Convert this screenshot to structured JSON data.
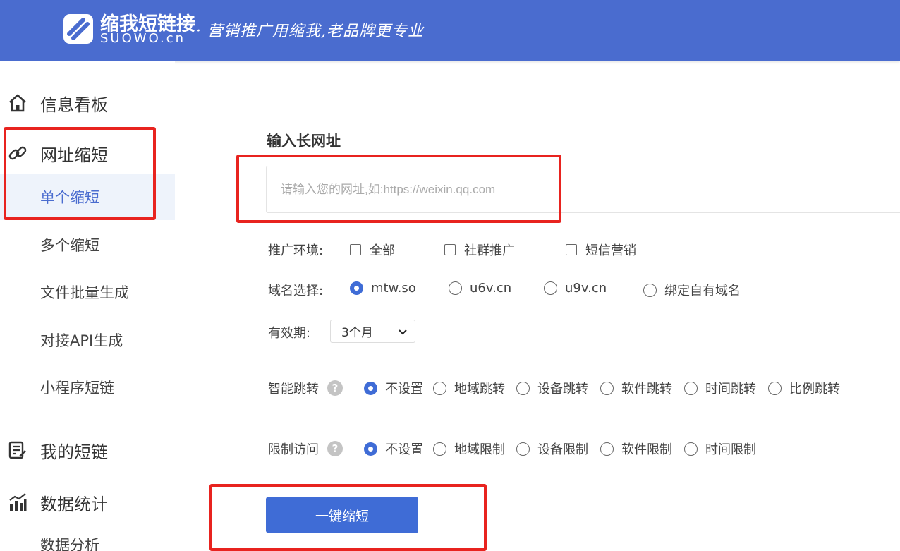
{
  "header": {
    "logo_cn": "缩我短链接",
    "logo_en": "SUOWO.cn",
    "slogan": "· 营销推广用缩我,老品牌更专业",
    "bg_color": "#4a6ccf"
  },
  "sidebar": {
    "items": [
      {
        "label": "信息看板",
        "icon": "home-icon"
      },
      {
        "label": "网址缩短",
        "icon": "link-icon"
      },
      {
        "label": "单个缩短",
        "active": true
      },
      {
        "label": "多个缩短"
      },
      {
        "label": "文件批量生成"
      },
      {
        "label": "对接API生成"
      },
      {
        "label": "小程序短链"
      },
      {
        "label": "我的短链",
        "icon": "list-icon"
      },
      {
        "label": "数据统计",
        "icon": "chart-icon"
      },
      {
        "label": "数据分析"
      }
    ]
  },
  "main": {
    "section_title": "输入长网址",
    "url_input": {
      "value": "",
      "placeholder": "请输入您的网址,如:https://weixin.qq.com"
    },
    "promo_env": {
      "label": "推广环境:",
      "options": [
        {
          "label": "全部",
          "checked": false
        },
        {
          "label": "社群推广",
          "checked": false
        },
        {
          "label": "短信营销",
          "checked": false
        }
      ]
    },
    "domain": {
      "label": "域名选择:",
      "options": [
        {
          "label": "mtw.so",
          "selected": true
        },
        {
          "label": "u6v.cn",
          "selected": false
        },
        {
          "label": "u9v.cn",
          "selected": false
        },
        {
          "label": "绑定自有域名",
          "selected": false
        }
      ]
    },
    "validity": {
      "label": "有效期:",
      "value": "3个月"
    },
    "smart_redirect": {
      "label": "智能跳转",
      "help": "?",
      "options": [
        {
          "label": "不设置",
          "selected": true
        },
        {
          "label": "地域跳转",
          "selected": false
        },
        {
          "label": "设备跳转",
          "selected": false
        },
        {
          "label": "软件跳转",
          "selected": false
        },
        {
          "label": "时间跳转",
          "selected": false
        },
        {
          "label": "比例跳转",
          "selected": false
        }
      ]
    },
    "restrict_access": {
      "label": "限制访问",
      "help": "?",
      "options": [
        {
          "label": "不设置",
          "selected": true
        },
        {
          "label": "地域限制",
          "selected": false
        },
        {
          "label": "设备限制",
          "selected": false
        },
        {
          "label": "软件限制",
          "selected": false
        },
        {
          "label": "时间限制",
          "selected": false
        }
      ]
    },
    "submit_label": "一键缩短"
  },
  "colors": {
    "accent": "#3f6cd6",
    "highlight": "#e8231f"
  }
}
